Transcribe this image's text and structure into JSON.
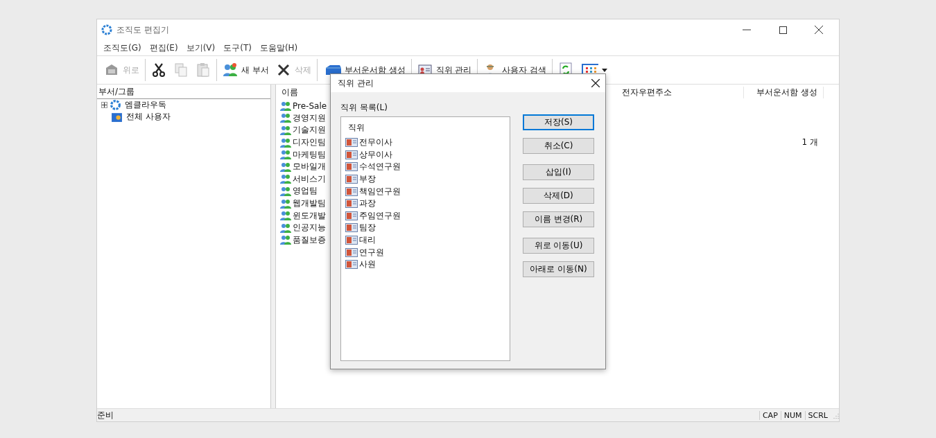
{
  "window": {
    "title": "조직도 편집기"
  },
  "menu": [
    {
      "label": "조직도(G)"
    },
    {
      "label": "편집(E)"
    },
    {
      "label": "보기(V)"
    },
    {
      "label": "도구(T)"
    },
    {
      "label": "도움말(H)"
    }
  ],
  "toolbar": [
    [
      {
        "label": "위로",
        "disabled": true
      }
    ],
    [
      {
        "disabled": false
      },
      {
        "disabled": true
      },
      {
        "disabled": true
      }
    ],
    [
      {
        "label": "새 부서",
        "disabled": false
      },
      {
        "label": "삭제",
        "disabled": true
      }
    ],
    [
      {
        "label": "부서운서함 생성",
        "disabled": false
      }
    ],
    [
      {
        "label": "직위 관리",
        "disabled": false
      }
    ],
    [
      {
        "label": "사용자 검색",
        "disabled": false
      }
    ],
    [
      {
        "disabled": false
      },
      {
        "disabled": false,
        "dropdown": true
      }
    ]
  ],
  "tree": {
    "heading": "부서/그룹",
    "items": [
      {
        "label": "엠클라우독",
        "expanded": false,
        "selected": false
      },
      {
        "label": "전체 사용자",
        "selected": false
      }
    ]
  },
  "list": {
    "columns": [
      {
        "label": "이름"
      },
      {
        "label": "전자우편주소"
      },
      {
        "label": "부서운서함 생성"
      }
    ],
    "rows": [
      {
        "name": "Pre-Sale"
      },
      {
        "name": "경영지원"
      },
      {
        "name": "기술지원"
      },
      {
        "name": "디자인팀",
        "mailbox": "1 개"
      },
      {
        "name": "마케팅팀"
      },
      {
        "name": "모바일개"
      },
      {
        "name": "서비스기"
      },
      {
        "name": "영업팀"
      },
      {
        "name": "웹개발팀"
      },
      {
        "name": "윈도개발"
      },
      {
        "name": "인공지능"
      },
      {
        "name": "품질보증"
      }
    ]
  },
  "dialog": {
    "title": "직위 관리",
    "list_label": "직위 목록(L)",
    "list_heading": "직위",
    "items": [
      {
        "label": "전무이사"
      },
      {
        "label": "상무이사"
      },
      {
        "label": "수석연구원"
      },
      {
        "label": "부장"
      },
      {
        "label": "책임연구원"
      },
      {
        "label": "과장"
      },
      {
        "label": "주임연구원"
      },
      {
        "label": "팀장"
      },
      {
        "label": "대리"
      },
      {
        "label": "연구원"
      },
      {
        "label": "사원"
      }
    ],
    "buttons": [
      [
        {
          "label": "저장(S)",
          "default": true
        },
        {
          "label": "취소(C)",
          "default": false
        }
      ],
      [
        {
          "label": "삽입(I)",
          "default": false
        },
        {
          "label": "삭제(D)",
          "default": false
        },
        {
          "label": "이름 변경(R)",
          "default": false
        }
      ],
      [
        {
          "label": "위로 이동(U)",
          "default": false
        },
        {
          "label": "아래로 이동(N)",
          "default": false
        }
      ]
    ]
  },
  "status_bar": {
    "text": "준비",
    "indicators": [
      "CAP",
      "NUM",
      "SCRL"
    ]
  }
}
